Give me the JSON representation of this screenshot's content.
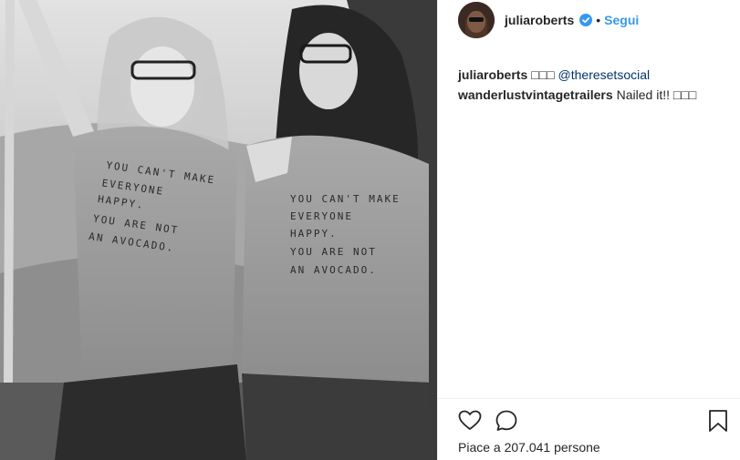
{
  "post": {
    "image": {
      "shirt_text_left": [
        "YOU CAN'T MAKE",
        "EVERYONE",
        "HAPPY.",
        "YOU ARE NOT",
        "AN AVOCADO."
      ],
      "shirt_text_right": [
        "YOU CAN'T MAKE",
        "EVERYONE",
        "HAPPY.",
        "YOU ARE NOT",
        "AN AVOCADO."
      ]
    }
  },
  "header": {
    "username": "juliaroberts",
    "separator": "•",
    "follow_label": "Segui"
  },
  "comments": [
    {
      "author": "juliaroberts",
      "text": "□□□ ",
      "mention": "@theresetsocial"
    },
    {
      "author": "wanderlustvintagetrailers",
      "text": "Nailed it!! □□□",
      "mention": ""
    }
  ],
  "footer": {
    "likes_text": "Piace a 207.041 persone",
    "icons": [
      "heart-icon",
      "comment-icon",
      "bookmark-icon"
    ]
  },
  "colors": {
    "accent": "#3897f0",
    "text": "#262626",
    "verified": "#3897f0"
  }
}
